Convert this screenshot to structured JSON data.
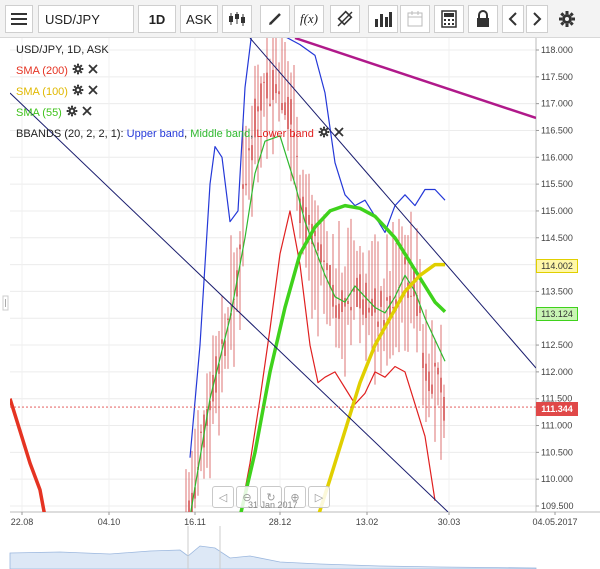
{
  "toolbar": {
    "symbol": "USD/JPY",
    "timeframe": "1D",
    "price_side": "ASK",
    "fx_label": "f(x)"
  },
  "legend": {
    "title": "USD/JPY, 1D, ASK",
    "sma200": "SMA (200)",
    "sma100": "SMA (100)",
    "sma55": "SMA (55)",
    "bbands_prefix": "BBANDS (20, 2, 2, 1): ",
    "bbands_upper": "Upper band",
    "bbands_sep1": ", ",
    "bbands_middle": "Middle band",
    "bbands_sep2": ", ",
    "bbands_lower": "Lower band"
  },
  "price_tags": {
    "sma100": "114.002",
    "sma55": "113.124",
    "last": "111.344"
  },
  "colors": {
    "sma200": "#e53322",
    "sma100": "#e0cf00",
    "sma55": "#3fd21c",
    "upper": "#2438d8",
    "middle": "#2eb82e",
    "lower": "#e02020",
    "candles": "#d45050",
    "trendline": "#b0198a",
    "channel": "#1a1d6e",
    "last_price": "#e04848"
  },
  "nav": {
    "date_label": "31 Jan 2017"
  },
  "chart_data": {
    "type": "line",
    "instrument": "USD/JPY",
    "timeframe": "1D",
    "ylim": [
      109.3,
      118.2
    ],
    "y_ticks": [
      "118.000",
      "117.500",
      "117.000",
      "116.500",
      "116.000",
      "115.500",
      "115.000",
      "114.500",
      "114.000",
      "113.500",
      "113.000",
      "112.500",
      "112.000",
      "111.500",
      "111.000",
      "110.500",
      "110.000",
      "109.500"
    ],
    "x_ticks": [
      "22.08",
      "04.10",
      "16.11",
      "28.12",
      "13.02",
      "30.03",
      "04.05.2017"
    ],
    "last_price": 111.344,
    "series": [
      {
        "name": "Upper band",
        "points": [
          [
            190,
            110.4
          ],
          [
            200,
            112.5
          ],
          [
            205,
            114.0
          ],
          [
            210,
            115.5
          ],
          [
            215,
            116.2
          ],
          [
            222,
            116.0
          ],
          [
            230,
            114.8
          ],
          [
            238,
            115.0
          ],
          [
            245,
            117.3
          ],
          [
            255,
            118.8
          ],
          [
            265,
            118.6
          ],
          [
            280,
            118.3
          ],
          [
            300,
            118.1
          ],
          [
            315,
            117.9
          ],
          [
            325,
            117.2
          ],
          [
            335,
            115.9
          ],
          [
            345,
            115.3
          ],
          [
            355,
            115.1
          ],
          [
            365,
            115.2
          ],
          [
            375,
            114.9
          ],
          [
            385,
            114.6
          ],
          [
            395,
            115.1
          ],
          [
            405,
            115.3
          ],
          [
            415,
            115.1
          ],
          [
            425,
            115.4
          ],
          [
            435,
            115.4
          ],
          [
            445,
            115.2
          ]
        ]
      },
      {
        "name": "Middle band",
        "points": [
          [
            190,
            109.3
          ],
          [
            210,
            111.5
          ],
          [
            230,
            113.0
          ],
          [
            245,
            114.5
          ],
          [
            255,
            115.7
          ],
          [
            265,
            116.3
          ],
          [
            280,
            116.4
          ],
          [
            295,
            115.5
          ],
          [
            305,
            114.8
          ],
          [
            315,
            114.3
          ],
          [
            325,
            113.8
          ],
          [
            335,
            113.4
          ],
          [
            345,
            113.3
          ],
          [
            355,
            113.6
          ],
          [
            365,
            113.4
          ],
          [
            375,
            113.2
          ],
          [
            385,
            113.1
          ],
          [
            395,
            113.4
          ],
          [
            405,
            113.8
          ],
          [
            415,
            113.5
          ],
          [
            425,
            113.0
          ],
          [
            435,
            112.6
          ],
          [
            445,
            112.2
          ]
        ]
      },
      {
        "name": "Lower band",
        "points": [
          [
            240,
            109.3
          ],
          [
            250,
            110.3
          ],
          [
            260,
            111.5
          ],
          [
            270,
            112.8
          ],
          [
            280,
            114.2
          ],
          [
            290,
            115.0
          ],
          [
            300,
            114.0
          ],
          [
            310,
            112.5
          ],
          [
            318,
            111.8
          ],
          [
            325,
            111.9
          ],
          [
            335,
            112.0
          ],
          [
            345,
            111.7
          ],
          [
            355,
            111.4
          ],
          [
            365,
            111.6
          ],
          [
            375,
            112.0
          ],
          [
            385,
            111.9
          ],
          [
            395,
            112.1
          ],
          [
            405,
            112.0
          ],
          [
            415,
            111.4
          ],
          [
            425,
            110.8
          ],
          [
            435,
            109.6
          ]
        ]
      },
      {
        "name": "SMA (55)",
        "points": [
          [
            240,
            109.3
          ],
          [
            255,
            110.5
          ],
          [
            270,
            112.0
          ],
          [
            285,
            113.2
          ],
          [
            300,
            114.2
          ],
          [
            315,
            114.7
          ],
          [
            330,
            115.0
          ],
          [
            345,
            115.1
          ],
          [
            360,
            115.05
          ],
          [
            375,
            114.9
          ],
          [
            385,
            114.7
          ],
          [
            395,
            114.5
          ],
          [
            405,
            114.2
          ],
          [
            415,
            113.9
          ],
          [
            425,
            113.6
          ],
          [
            435,
            113.3
          ],
          [
            445,
            113.12
          ]
        ]
      },
      {
        "name": "SMA (100)",
        "points": [
          [
            318,
            109.3
          ],
          [
            330,
            110.0
          ],
          [
            345,
            110.9
          ],
          [
            360,
            111.8
          ],
          [
            375,
            112.5
          ],
          [
            390,
            113.0
          ],
          [
            405,
            113.5
          ],
          [
            420,
            113.8
          ],
          [
            435,
            114.0
          ],
          [
            445,
            114.0
          ]
        ]
      },
      {
        "name": "SMA (200)",
        "points": [
          [
            10,
            111.5
          ],
          [
            20,
            110.9
          ],
          [
            30,
            110.3
          ],
          [
            40,
            109.8
          ],
          [
            45,
            109.3
          ]
        ]
      }
    ]
  }
}
